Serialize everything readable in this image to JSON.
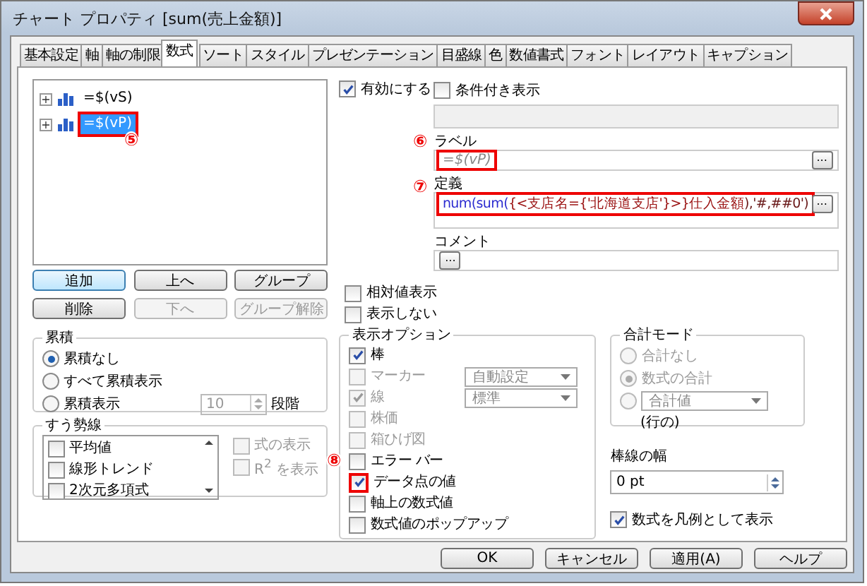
{
  "window": {
    "title": "チャート プロパティ [sum(売上金額)]"
  },
  "tabs": [
    {
      "label": "基本設定",
      "selected": false
    },
    {
      "label": "軸",
      "selected": false
    },
    {
      "label": "軸の制限",
      "selected": false
    },
    {
      "label": "数式",
      "selected": true
    },
    {
      "label": "ソート",
      "selected": false
    },
    {
      "label": "スタイル",
      "selected": false
    },
    {
      "label": "プレゼンテーション",
      "selected": false
    },
    {
      "label": "目盛線",
      "selected": false
    },
    {
      "label": "色",
      "selected": false
    },
    {
      "label": "数値書式",
      "selected": false
    },
    {
      "label": "フォント",
      "selected": false
    },
    {
      "label": "レイアウト",
      "selected": false
    },
    {
      "label": "キャプション",
      "selected": false
    }
  ],
  "expressions": [
    {
      "expander": "+",
      "label": "=$(vS)",
      "selected": false,
      "highlighted": false
    },
    {
      "expander": "+",
      "label": "=$(vP)",
      "selected": true,
      "highlighted": true,
      "callout": "⑤"
    }
  ],
  "expression_buttons": [
    {
      "label": "追加",
      "disabled": false,
      "default": true
    },
    {
      "label": "上へ",
      "disabled": false,
      "default": false
    },
    {
      "label": "グループ",
      "disabled": false,
      "default": false
    },
    {
      "label": "削除",
      "disabled": false,
      "default": false
    },
    {
      "label": "下へ",
      "disabled": true,
      "default": false
    },
    {
      "label": "グループ解除",
      "disabled": true,
      "default": false
    }
  ],
  "accumulation": {
    "title": "累積",
    "options": [
      {
        "label": "累積なし",
        "selected": true
      },
      {
        "label": "すべて累積表示",
        "selected": false
      },
      {
        "label": "累積表示",
        "selected": false
      }
    ],
    "steps": "10",
    "steps_unit": "段階"
  },
  "trendlines": {
    "title": "すう勢線",
    "items": [
      {
        "label": "平均値",
        "checked": false
      },
      {
        "label": "線形トレンド",
        "checked": false
      },
      {
        "label": "2次元多項式",
        "checked": false
      }
    ],
    "options": [
      {
        "label": "式の表示",
        "checked": false,
        "disabled": true
      },
      {
        "label": "R$^{2}$ を表示",
        "checked": false,
        "disabled": true
      }
    ]
  },
  "enable": {
    "label": "有効にする",
    "checked": true
  },
  "conditional": {
    "label": "条件付き表示",
    "checked": false
  },
  "label_field": {
    "title": "ラベル",
    "value": "=$(vP)",
    "callout": "⑥",
    "highlighted": true,
    "ellipsis": "..."
  },
  "definition": {
    "title": "定義",
    "callout": "⑦",
    "highlighted": true,
    "ellipsis": "...",
    "parts": [
      {
        "text": "num(sum(",
        "color": "#2b2bd0"
      },
      {
        "text": "{<支店名={'北海道支店'}>}仕入金額",
        "color": "#9a1010"
      },
      {
        "text": "),'#,##0')",
        "color": "#6a1a1a"
      }
    ]
  },
  "comment": {
    "title": "コメント",
    "ellipsis": "..."
  },
  "flags": [
    {
      "label": "相対値表示",
      "checked": false
    },
    {
      "label": "表示しない",
      "checked": false
    }
  ],
  "display_options": {
    "title": "表示オプション",
    "items": [
      {
        "label": "棒",
        "checked": true,
        "disabled": false
      },
      {
        "label": "マーカー",
        "checked": false,
        "disabled": true,
        "dropdown": "自動設定"
      },
      {
        "label": "線",
        "checked": true,
        "disabled": true,
        "dropdown": "標準"
      },
      {
        "label": "株価",
        "checked": false,
        "disabled": true
      },
      {
        "label": "箱ひげ図",
        "checked": false,
        "disabled": true
      },
      {
        "label": "エラー バー",
        "checked": false,
        "disabled": false,
        "callout": "⑧"
      },
      {
        "label": "データ点の値",
        "checked": true,
        "disabled": false,
        "highlighted": true
      },
      {
        "label": "軸上の数式値",
        "checked": false,
        "disabled": false
      },
      {
        "label": "数式値のポップアップ",
        "checked": false,
        "disabled": false
      }
    ]
  },
  "total_mode": {
    "title": "合計モード",
    "options": [
      {
        "label": "合計なし",
        "selected": false,
        "disabled": true
      },
      {
        "label": "数式の合計",
        "selected": true,
        "disabled": true
      },
      {
        "dropdown": "合計値",
        "note": "(行の)",
        "selected": false,
        "disabled": true
      }
    ]
  },
  "bar_width": {
    "title": "棒線の幅",
    "value": "0 pt"
  },
  "legend": {
    "label": "数式を凡例として表示",
    "checked": true
  },
  "footer_buttons": [
    {
      "label": "OK"
    },
    {
      "label": "キャンセル"
    },
    {
      "label": "適用(A)"
    },
    {
      "label": "ヘルプ"
    }
  ]
}
